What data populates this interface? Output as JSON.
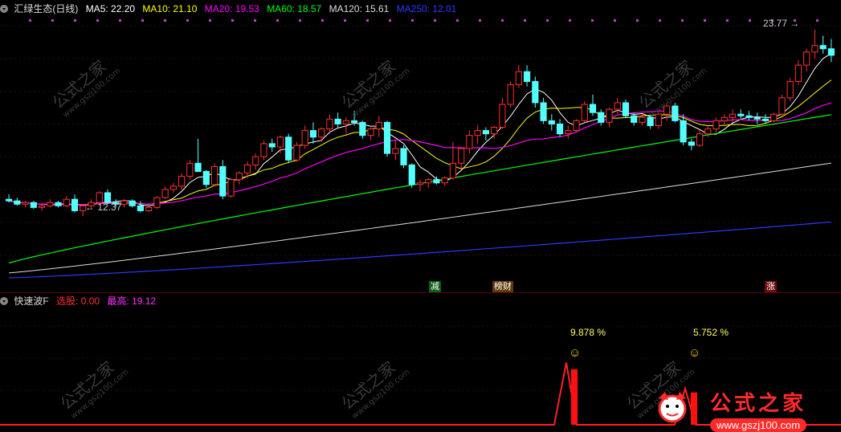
{
  "main_legend": {
    "title": "汇绿生态(日线)",
    "items": [
      {
        "label": "MA5: 22.20",
        "color": "#ffffff"
      },
      {
        "label": "MA10: 21.10",
        "color": "#ffff00"
      },
      {
        "label": "MA20: 19.53",
        "color": "#ff00ff"
      },
      {
        "label": "MA60: 18.57",
        "color": "#00ff00"
      },
      {
        "label": "MA120: 15.61",
        "color": "#dddddd"
      },
      {
        "label": "MA250: 12.01",
        "color": "#2a3aff"
      }
    ]
  },
  "annotations": {
    "high_label": "23.77",
    "low_label": "12.37"
  },
  "event_tags": [
    {
      "label": "减",
      "bg": "#0b5e1a",
      "color": "#ffffff"
    },
    {
      "label": "榜财",
      "bg": "#5e3a0b",
      "color": "#ffffff"
    },
    {
      "label": "涨",
      "bg": "#6e0b0b",
      "color": "#ffffff"
    }
  ],
  "sub_legend": {
    "title": "快速波F",
    "items": [
      {
        "label": "选股: 0.00",
        "color": "#ff3030"
      },
      {
        "label": "最高: 19.12",
        "color": "#ff30ff"
      }
    ]
  },
  "sub_annotations": [
    {
      "label": "9.878 %"
    },
    {
      "label": "5.752 %"
    }
  ],
  "watermark": {
    "text": "公式之家",
    "url": "www.gszj100.com"
  },
  "colors": {
    "up": "#ff3030",
    "down": "#54ffff",
    "ma5": "#ffffff",
    "ma10": "#ffff00",
    "ma20": "#ff00ff",
    "ma60": "#00ff00",
    "ma120": "#dddddd",
    "ma250": "#2a3aff",
    "background": "#000000"
  },
  "chart_data": [
    {
      "type": "candlestick",
      "title": "汇绿生态(日线)",
      "ylim": [
        8.5,
        24.5
      ],
      "candles": [
        [
          13.4,
          13.7,
          13.2,
          13.3
        ],
        [
          13.3,
          13.5,
          13.0,
          13.1
        ],
        [
          13.1,
          13.3,
          12.9,
          13.2
        ],
        [
          13.2,
          13.3,
          12.8,
          12.9
        ],
        [
          12.9,
          13.1,
          12.7,
          13.0
        ],
        [
          13.0,
          13.4,
          12.9,
          13.2
        ],
        [
          13.2,
          13.3,
          12.9,
          13.0
        ],
        [
          13.0,
          13.6,
          12.9,
          13.4
        ],
        [
          13.4,
          13.7,
          12.6,
          12.7
        ],
        [
          12.7,
          13.1,
          12.37,
          13.0
        ],
        [
          13.0,
          13.4,
          12.8,
          13.2
        ],
        [
          13.2,
          13.9,
          13.1,
          13.8
        ],
        [
          13.8,
          14.0,
          13.1,
          13.2
        ],
        [
          13.2,
          13.4,
          12.9,
          13.1
        ],
        [
          13.1,
          13.4,
          12.9,
          13.3
        ],
        [
          13.3,
          13.4,
          12.9,
          13.0
        ],
        [
          13.0,
          13.3,
          12.6,
          12.7
        ],
        [
          12.7,
          13.0,
          12.6,
          12.9
        ],
        [
          12.9,
          13.6,
          12.8,
          13.5
        ],
        [
          13.5,
          14.2,
          13.4,
          14.0
        ],
        [
          14.0,
          14.4,
          13.8,
          14.2
        ],
        [
          14.2,
          15.0,
          14.0,
          14.8
        ],
        [
          14.8,
          15.8,
          14.6,
          15.6
        ],
        [
          15.6,
          17.1,
          15.2,
          15.1
        ],
        [
          15.1,
          15.2,
          14.1,
          14.3
        ],
        [
          14.3,
          15.6,
          14.2,
          15.4
        ],
        [
          15.4,
          15.8,
          13.4,
          13.6
        ],
        [
          13.6,
          14.7,
          13.5,
          14.6
        ],
        [
          14.6,
          15.1,
          14.3,
          15.0
        ],
        [
          15.0,
          15.7,
          14.7,
          15.5
        ],
        [
          15.5,
          16.2,
          15.2,
          16.0
        ],
        [
          16.0,
          17.0,
          15.8,
          16.8
        ],
        [
          16.8,
          17.1,
          16.3,
          16.6
        ],
        [
          16.6,
          17.3,
          16.2,
          17.2
        ],
        [
          17.2,
          17.4,
          15.6,
          15.8
        ],
        [
          15.8,
          16.9,
          15.7,
          16.7
        ],
        [
          16.7,
          17.9,
          16.5,
          17.6
        ],
        [
          17.6,
          18.1,
          16.8,
          17.2
        ],
        [
          17.2,
          17.8,
          16.9,
          17.7
        ],
        [
          17.7,
          18.6,
          17.4,
          18.3
        ],
        [
          18.3,
          18.7,
          17.8,
          18.0
        ],
        [
          18.0,
          18.4,
          17.4,
          18.2
        ],
        [
          18.2,
          18.8,
          17.9,
          18.1
        ],
        [
          18.1,
          18.2,
          17.1,
          17.3
        ],
        [
          17.3,
          17.8,
          17.0,
          17.7
        ],
        [
          17.7,
          18.5,
          17.2,
          18.1
        ],
        [
          18.1,
          18.2,
          16.0,
          16.2
        ],
        [
          16.2,
          17.0,
          15.8,
          16.5
        ],
        [
          16.5,
          16.7,
          15.3,
          15.5
        ],
        [
          15.5,
          15.6,
          14.1,
          14.3
        ],
        [
          14.3,
          14.6,
          13.9,
          14.4
        ],
        [
          14.4,
          14.7,
          14.1,
          14.6
        ],
        [
          14.6,
          14.8,
          14.3,
          14.4
        ],
        [
          14.4,
          14.8,
          14.2,
          14.7
        ],
        [
          14.7,
          16.9,
          14.6,
          15.6
        ],
        [
          15.6,
          16.6,
          15.2,
          16.5
        ],
        [
          16.5,
          17.6,
          16.2,
          17.3
        ],
        [
          17.3,
          17.9,
          16.8,
          17.6
        ],
        [
          17.6,
          17.8,
          17.0,
          17.4
        ],
        [
          17.4,
          17.9,
          17.1,
          17.8
        ],
        [
          17.8,
          19.6,
          17.7,
          19.2
        ],
        [
          19.2,
          20.6,
          19.0,
          20.4
        ],
        [
          20.4,
          21.6,
          20.2,
          21.2
        ],
        [
          21.2,
          21.6,
          20.3,
          20.6
        ],
        [
          20.6,
          20.9,
          19.0,
          19.3
        ],
        [
          19.3,
          19.6,
          18.0,
          18.2
        ],
        [
          18.2,
          18.6,
          17.6,
          18.0
        ],
        [
          18.0,
          18.3,
          17.2,
          17.4
        ],
        [
          17.4,
          17.9,
          17.1,
          17.6
        ],
        [
          17.6,
          18.3,
          17.5,
          18.2
        ],
        [
          18.2,
          19.4,
          18.1,
          19.2
        ],
        [
          19.2,
          19.8,
          18.5,
          18.7
        ],
        [
          18.7,
          18.9,
          17.9,
          18.1
        ],
        [
          18.1,
          19.0,
          17.8,
          18.9
        ],
        [
          18.9,
          19.6,
          18.6,
          19.3
        ],
        [
          19.3,
          19.5,
          18.4,
          18.5
        ],
        [
          18.5,
          18.7,
          17.9,
          18.1
        ],
        [
          18.1,
          18.6,
          17.9,
          18.4
        ],
        [
          18.4,
          18.6,
          17.7,
          17.9
        ],
        [
          17.9,
          18.7,
          17.7,
          18.6
        ],
        [
          18.6,
          19.3,
          18.2,
          19.1
        ],
        [
          19.1,
          19.3,
          18.1,
          18.2
        ],
        [
          18.2,
          18.6,
          16.7,
          16.9
        ],
        [
          16.9,
          17.1,
          16.4,
          16.7
        ],
        [
          16.7,
          17.6,
          16.6,
          17.4
        ],
        [
          17.4,
          17.9,
          17.2,
          17.7
        ],
        [
          17.7,
          18.4,
          17.5,
          18.2
        ],
        [
          18.2,
          18.6,
          17.9,
          18.4
        ],
        [
          18.4,
          18.9,
          18.1,
          18.6
        ],
        [
          18.6,
          18.9,
          18.3,
          18.5
        ],
        [
          18.5,
          18.8,
          18.2,
          18.4
        ],
        [
          18.4,
          18.7,
          18.0,
          18.3
        ],
        [
          18.3,
          18.6,
          18.0,
          18.2
        ],
        [
          18.2,
          18.7,
          18.1,
          18.6
        ],
        [
          18.6,
          19.8,
          18.5,
          19.6
        ],
        [
          19.6,
          20.8,
          19.4,
          20.6
        ],
        [
          20.6,
          21.9,
          20.4,
          21.6
        ],
        [
          21.6,
          22.6,
          21.2,
          22.4
        ],
        [
          22.4,
          23.77,
          22.0,
          22.8
        ],
        [
          22.8,
          23.4,
          22.3,
          22.6
        ],
        [
          22.6,
          23.2,
          21.8,
          22.2
        ]
      ],
      "ma_last": {
        "MA5": 22.2,
        "MA10": 21.1,
        "MA20": 19.53,
        "MA60": 18.57,
        "MA120": 15.61,
        "MA250": 12.01
      },
      "high": 23.77,
      "low": 12.37
    },
    {
      "type": "line",
      "title": "快速波F",
      "series": [
        {
          "name": "选股",
          "values_peak": [
            9.878,
            5.752
          ]
        }
      ],
      "ylim": [
        0,
        19.12
      ]
    }
  ]
}
